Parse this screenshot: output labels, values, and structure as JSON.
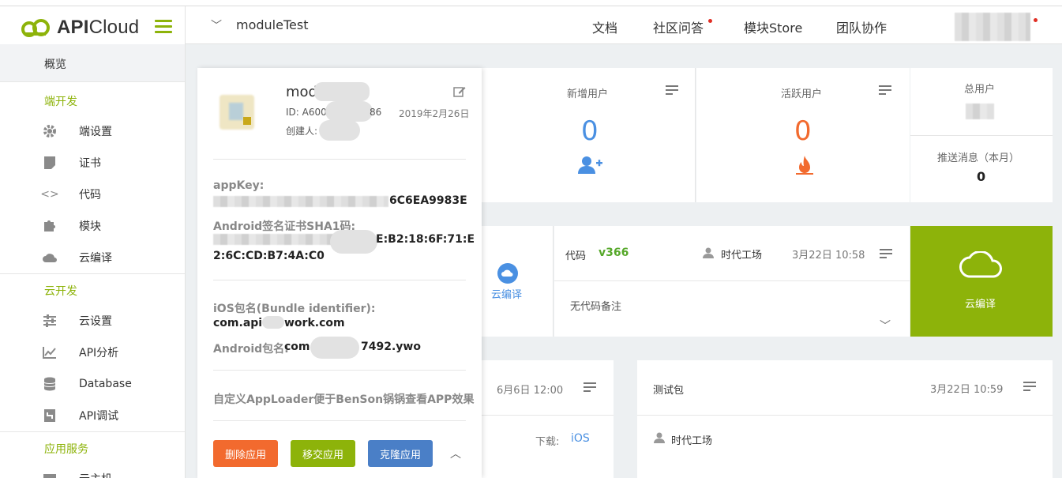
{
  "logo": {
    "bold": "API",
    "rest": "Cloud"
  },
  "header": {
    "project": "moduleTest",
    "nav": [
      "文档",
      "社区问答",
      "模块Store",
      "团队协作"
    ]
  },
  "sidebar": {
    "overview": "概览",
    "sections": [
      {
        "title": "端开发",
        "items": [
          {
            "label": "端设置",
            "icon": "gear-icon"
          },
          {
            "label": "证书",
            "icon": "certificate-icon"
          },
          {
            "label": "代码",
            "icon": "code-icon"
          },
          {
            "label": "模块",
            "icon": "puzzle-icon"
          },
          {
            "label": "云编译",
            "icon": "cloud-icon"
          }
        ]
      },
      {
        "title": "云开发",
        "items": [
          {
            "label": "云设置",
            "icon": "sliders-icon"
          },
          {
            "label": "API分析",
            "icon": "chart-icon"
          },
          {
            "label": "Database",
            "icon": "database-icon"
          },
          {
            "label": "API调试",
            "icon": "debug-icon"
          }
        ]
      },
      {
        "title": "应用服务",
        "items": [
          {
            "label": "云主机",
            "icon": "server-icon"
          }
        ]
      }
    ]
  },
  "app_card": {
    "name": "mod",
    "id_prefix": "ID: A600",
    "id_suffix": "86",
    "date": "2019年2月26日",
    "creator_label": "创建人:",
    "appkey_label": "appKey:",
    "appkey_tail": "6C6EA9983E",
    "sha1_label": "Android签名证书SHA1码:",
    "sha1_line1_tail": "E:B2:18:6F:71:E",
    "sha1_line2": "2:6C:CD:B7:4A:C0",
    "ios_label": "iOS包名(Bundle identifier):",
    "ios_prefix": "com.api",
    "ios_suffix": "work.com",
    "android_label": "Android包名:",
    "android_prefix": "com",
    "android_suffix": "7492.ywo",
    "description": "自定义AppLoader便于BenSon锅锅查看APP效果",
    "buttons": {
      "delete": "删除应用",
      "transfer": "移交应用",
      "clone": "克隆应用"
    }
  },
  "stats": {
    "new_users": {
      "label": "新增用户",
      "value": "0"
    },
    "active_users": {
      "label": "活跃用户",
      "value": "0"
    },
    "total_users": {
      "label": "总用户"
    },
    "push": {
      "label": "推送消息（本月）",
      "value": "0"
    }
  },
  "build": {
    "cloud_compile_link": "云编译",
    "code_label": "代码",
    "version": "v366",
    "author": "时代工场",
    "time": "3月22日 10:58",
    "note": "无代码备注",
    "cloud_button": "云编译"
  },
  "packages": {
    "left": {
      "time": "6月6日 12:00",
      "download_label": "下载:",
      "platform": "iOS"
    },
    "right": {
      "title": "测试包",
      "time": "3月22日 10:59",
      "author": "时代工场"
    }
  },
  "colors": {
    "brand": "#8db30a",
    "blue": "#4a90e2",
    "orange": "#f26a2e",
    "delete": "#f26a2e",
    "transfer": "#8db30a",
    "clone": "#4a7fc7"
  }
}
